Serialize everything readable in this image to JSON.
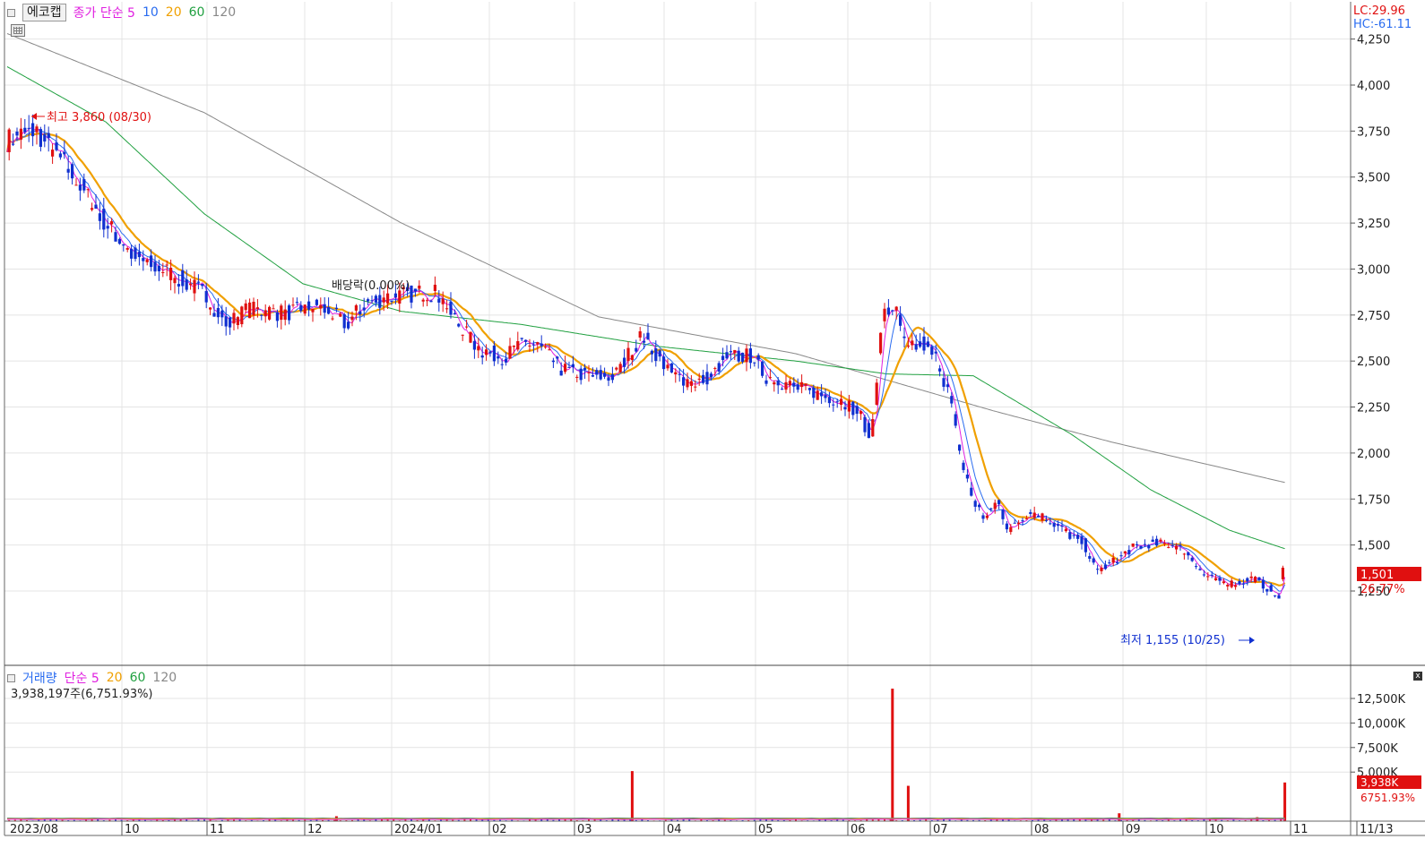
{
  "price_panel": {
    "title": "에코캡",
    "ma_label": "종가 단순 5",
    "ma_periods": [
      "10",
      "20",
      "60",
      "120"
    ],
    "ma_colors": {
      "ma5": "#e020e0",
      "ma10": "#2a6cf0",
      "ma20": "#f0a000",
      "ma60": "#20a040",
      "ma120": "#888888"
    },
    "lc_text": "LC:29.96",
    "hc_text": "HC:-61.11",
    "high_marker": "최고 3,860 (08/30)",
    "low_marker": "최저 1,155 (10/25)",
    "dividend_label": "배당락(0.00%)",
    "current_price": "1,501",
    "current_change": "26.77%",
    "y_ticks": [
      "4,250",
      "4,000",
      "3,750",
      "3,500",
      "3,250",
      "3,000",
      "2,750",
      "2,500",
      "2,250",
      "2,000",
      "1,750",
      "1,500",
      "1,250"
    ]
  },
  "volume_panel": {
    "title": "거래량",
    "ma_label": "단순 5",
    "ma_periods": [
      "20",
      "60",
      "120"
    ],
    "volume_text": "3,938,197주(6,751.93%)",
    "y_ticks": [
      "12,500K",
      "10,000K",
      "7,500K",
      "5,000K"
    ],
    "current_volume": "3,938K",
    "current_volume_pct": "6751.93%"
  },
  "x_axis": [
    "2023/08",
    "10",
    "11",
    "12",
    "2024/01",
    "02",
    "03",
    "04",
    "05",
    "06",
    "07",
    "08",
    "09",
    "10",
    "11",
    "11/13"
  ],
  "colors": {
    "up": "#e01010",
    "down": "#1030d0",
    "grid": "#e4e4e4",
    "axis": "#555555"
  },
  "chart_data": {
    "type": "candlestick",
    "price_anchors": [
      [
        0,
        3700
      ],
      [
        14,
        3760
      ],
      [
        30,
        3560
      ],
      [
        50,
        3250
      ],
      [
        65,
        3060
      ],
      [
        82,
        2980
      ],
      [
        98,
        2880
      ],
      [
        112,
        2700
      ],
      [
        122,
        2780
      ],
      [
        140,
        2760
      ],
      [
        158,
        2800
      ],
      [
        172,
        2700
      ],
      [
        182,
        2820
      ],
      [
        195,
        2850
      ],
      [
        208,
        2870
      ],
      [
        218,
        2870
      ],
      [
        230,
        2680
      ],
      [
        240,
        2560
      ],
      [
        252,
        2520
      ],
      [
        262,
        2600
      ],
      [
        270,
        2580
      ],
      [
        280,
        2460
      ],
      [
        295,
        2420
      ],
      [
        308,
        2420
      ],
      [
        316,
        2550
      ],
      [
        322,
        2640
      ],
      [
        330,
        2530
      ],
      [
        338,
        2420
      ],
      [
        348,
        2380
      ],
      [
        357,
        2420
      ],
      [
        364,
        2520
      ],
      [
        378,
        2530
      ],
      [
        384,
        2420
      ],
      [
        396,
        2370
      ],
      [
        408,
        2330
      ],
      [
        424,
        2280
      ],
      [
        432,
        2220
      ],
      [
        438,
        2080
      ],
      [
        444,
        2740
      ],
      [
        450,
        2800
      ],
      [
        456,
        2550
      ],
      [
        464,
        2600
      ],
      [
        472,
        2500
      ],
      [
        478,
        2300
      ],
      [
        484,
        1950
      ],
      [
        490,
        1740
      ],
      [
        496,
        1640
      ],
      [
        502,
        1740
      ],
      [
        508,
        1580
      ],
      [
        518,
        1680
      ],
      [
        528,
        1640
      ],
      [
        538,
        1560
      ],
      [
        546,
        1510
      ],
      [
        552,
        1360
      ],
      [
        560,
        1400
      ],
      [
        570,
        1480
      ],
      [
        580,
        1510
      ],
      [
        592,
        1500
      ],
      [
        600,
        1440
      ],
      [
        606,
        1340
      ],
      [
        614,
        1300
      ],
      [
        622,
        1290
      ],
      [
        632,
        1320
      ],
      [
        640,
        1260
      ],
      [
        645,
        1200
      ],
      [
        648,
        1501
      ]
    ],
    "ma120_anchors": [
      [
        0,
        4280
      ],
      [
        100,
        3850
      ],
      [
        200,
        3250
      ],
      [
        300,
        2740
      ],
      [
        400,
        2540
      ],
      [
        500,
        2230
      ],
      [
        560,
        2060
      ],
      [
        648,
        1840
      ]
    ],
    "ma60_anchors": [
      [
        0,
        4100
      ],
      [
        50,
        3800
      ],
      [
        100,
        3300
      ],
      [
        150,
        2920
      ],
      [
        200,
        2770
      ],
      [
        260,
        2700
      ],
      [
        330,
        2580
      ],
      [
        400,
        2500
      ],
      [
        446,
        2430
      ],
      [
        490,
        2420
      ],
      [
        540,
        2100
      ],
      [
        580,
        1800
      ],
      [
        620,
        1580
      ],
      [
        648,
        1480
      ]
    ],
    "volume_spikes": [
      [
        167,
        500
      ],
      [
        317,
        5100
      ],
      [
        449,
        13500
      ],
      [
        457,
        3600
      ],
      [
        564,
        800
      ],
      [
        634,
        400
      ],
      [
        648,
        3938
      ]
    ]
  }
}
